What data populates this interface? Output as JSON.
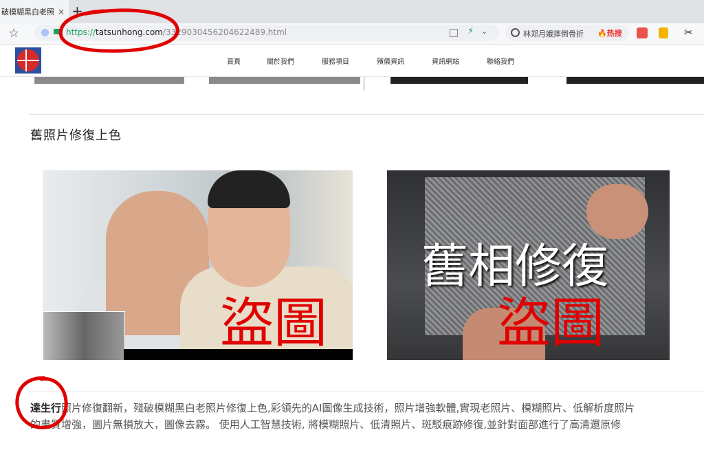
{
  "browser": {
    "tab_title": "破模糊黑白老照",
    "tab_close": "×",
    "new_tab": "+",
    "url_scheme": "https://",
    "url_host": "tatsunhong.com",
    "url_path": "/3329030456204622489.html",
    "search_text": "林郑月娥摔倒骨折",
    "search_hot": "🔥热搜",
    "star_glyph": "☆",
    "chevron_glyph": "⌄",
    "bolt_glyph": "⚡",
    "scissors_glyph": "✂"
  },
  "nav": {
    "items": [
      "首頁",
      "關於我們",
      "服務項目",
      "殯儀資訊",
      "資訊網站",
      "聯絡我們"
    ]
  },
  "section": {
    "title": "舊照片修復上色"
  },
  "images": {
    "right_title": "舊相修復",
    "watermark": "盜圖"
  },
  "content": {
    "brand": "達生行",
    "line1_rest": "照片修復翻新，殘破模糊黑白老照片修復上色,彩領先的AI圖像生成技術，照片增強軟體,實現老照片、模糊照片、低解析度照片",
    "line2": "的畫質增強，圖片無損放大，圖像去霧。 使用人工智慧技術, 將模糊照片、低清照片、斑駁痕跡修復,並針對面部進行了高清還原修"
  },
  "colors": {
    "annotation_red": "#e00000",
    "secure_green": "#1aa260"
  }
}
